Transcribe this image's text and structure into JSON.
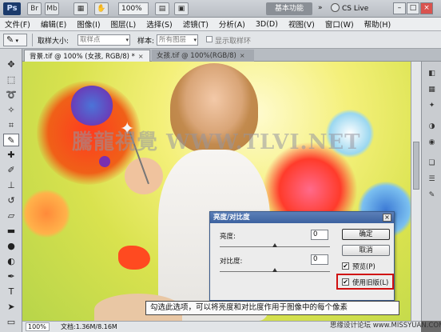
{
  "app": {
    "logo": "Ps",
    "zoom": "100%",
    "workspace_label": "基本功能",
    "cs_live": "CS Live",
    "window_buttons": [
      "–",
      "□",
      "×"
    ]
  },
  "menu": [
    "文件(F)",
    "编辑(E)",
    "图像(I)",
    "图层(L)",
    "选择(S)",
    "滤镜(T)",
    "分析(A)",
    "3D(D)",
    "视图(V)",
    "窗口(W)",
    "帮助(H)"
  ],
  "options_bar": {
    "sample_size_label": "取样大小:",
    "sample_size_value": "取样点",
    "sample_label": "样本:",
    "sample_value": "所有图层",
    "show_ring_label": "显示取样环"
  },
  "tabs": [
    {
      "label": "背景.tif @ 100% (女孩, RGB/8) *",
      "close": "×"
    },
    {
      "label": "女孩.tif @ 100%(RGB/8)",
      "close": "×"
    }
  ],
  "canvas": {
    "watermark": "騰龍視覺 WWW.TLVI.NET"
  },
  "status": {
    "zoom": "100%",
    "doc_info": "文档:1.36M/8.16M"
  },
  "dialog": {
    "title": "亮度/对比度",
    "close": "×",
    "brightness_label": "亮度:",
    "brightness_value": "0",
    "contrast_label": "对比度:",
    "contrast_value": "0",
    "ok_label": "确定",
    "cancel_label": "取消",
    "preview_label": "预览(P)",
    "preview_checked": true,
    "legacy_label": "使用旧版(L)",
    "legacy_checked": true,
    "check_mark": "✔"
  },
  "caption": "勾选此选项，可以将亮度和对比度作用于图像中的每个像素",
  "site_mark": "思缘设计论坛  www.MISSYUAN.COM",
  "colors": {
    "title_bar": "#3d62a0",
    "highlight": "#d01010"
  }
}
